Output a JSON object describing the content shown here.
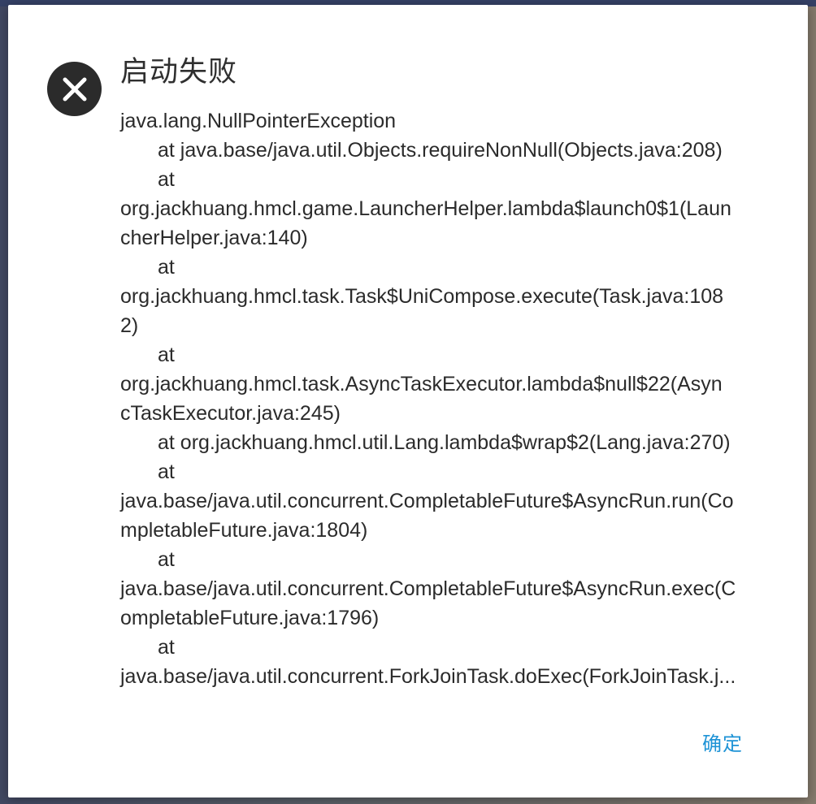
{
  "dialog": {
    "title": "启动失败",
    "icon": "error-circle-icon",
    "ok_label": "确定",
    "accent_color": "#1e93d6",
    "message_lines": [
      {
        "text": "java.lang.NullPointerException",
        "indent": false
      },
      {
        "text": "at java.base/java.util.Objects.requireNonNull(Objects.java:208)",
        "indent": true
      },
      {
        "text": "at",
        "indent": true
      },
      {
        "text": "org.jackhuang.hmcl.game.LauncherHelper.lambda$launch0$1(Laun",
        "indent": false
      },
      {
        "text": "cherHelper.java:140)",
        "indent": false
      },
      {
        "text": "at",
        "indent": true
      },
      {
        "text": "org.jackhuang.hmcl.task.Task$UniCompose.execute(Task.java:108",
        "indent": false
      },
      {
        "text": "2)",
        "indent": false
      },
      {
        "text": "at",
        "indent": true
      },
      {
        "text": "org.jackhuang.hmcl.task.AsyncTaskExecutor.lambda$null$22(Asyn",
        "indent": false
      },
      {
        "text": "cTaskExecutor.java:245)",
        "indent": false
      },
      {
        "text": "at org.jackhuang.hmcl.util.Lang.lambda$wrap$2(Lang.java:270)",
        "indent": true
      },
      {
        "text": "at",
        "indent": true
      },
      {
        "text": "java.base/java.util.concurrent.CompletableFuture$AsyncRun.run(Co",
        "indent": false
      },
      {
        "text": "mpletableFuture.java:1804)",
        "indent": false
      },
      {
        "text": "at",
        "indent": true
      },
      {
        "text": "java.base/java.util.concurrent.CompletableFuture$AsyncRun.exec(C",
        "indent": false
      },
      {
        "text": "ompletableFuture.java:1796)",
        "indent": false
      },
      {
        "text": "at",
        "indent": true
      },
      {
        "text": "java.base/java.util.concurrent.ForkJoinTask.doExec(ForkJoinTask.j...",
        "indent": false
      }
    ]
  }
}
